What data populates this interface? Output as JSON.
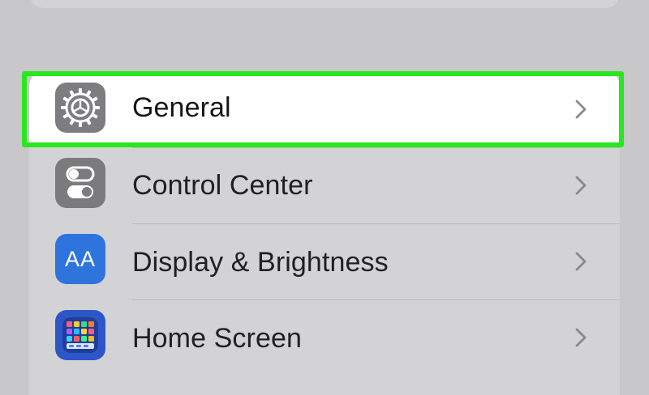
{
  "settings": {
    "items": [
      {
        "label": "General",
        "icon": "gear-icon",
        "icon_bg": "#7d7d80",
        "selected": true
      },
      {
        "label": "Control Center",
        "icon": "control-center-icon",
        "icon_bg": "#7b7b7e"
      },
      {
        "label": "Display & Brightness",
        "icon": "display-brightness-icon",
        "icon_bg": "#2f74dd",
        "icon_text": "AA"
      },
      {
        "label": "Home Screen",
        "icon": "home-screen-icon",
        "icon_bg": "#2d57c8"
      }
    ]
  },
  "colors": {
    "background": "#c8c8ca",
    "group_background": "#d3d3d5",
    "highlight": "#27e81c",
    "chevron": "#8a8a8e"
  }
}
